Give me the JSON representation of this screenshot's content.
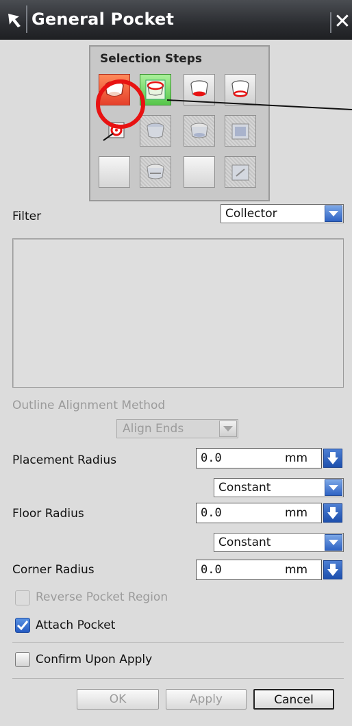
{
  "window": {
    "title": "General Pocket",
    "close_symbol": "✕"
  },
  "selection_steps": {
    "title": "Selection Steps"
  },
  "filter": {
    "label": "Filter",
    "value": "Collector"
  },
  "outline_alignment": {
    "label": "Outline Alignment Method",
    "value": "Align Ends"
  },
  "placement_radius": {
    "label": "Placement Radius",
    "value": "0.0",
    "unit": "mm",
    "mode": "Constant"
  },
  "floor_radius": {
    "label": "Floor Radius",
    "value": "0.0",
    "unit": "mm",
    "mode": "Constant"
  },
  "corner_radius": {
    "label": "Corner Radius",
    "value": "0.0",
    "unit": "mm"
  },
  "options": {
    "reverse_pocket_region": {
      "label": "Reverse Pocket Region",
      "checked": false,
      "enabled": false
    },
    "attach_pocket": {
      "label": "Attach Pocket",
      "checked": true
    },
    "confirm_upon_apply": {
      "label": "Confirm Upon Apply",
      "checked": false
    }
  },
  "buttons": {
    "ok": "OK",
    "apply": "Apply",
    "cancel": "Cancel"
  },
  "colors": {
    "annotation_red": "#e81212",
    "accent_blue": "#2f63c4"
  }
}
